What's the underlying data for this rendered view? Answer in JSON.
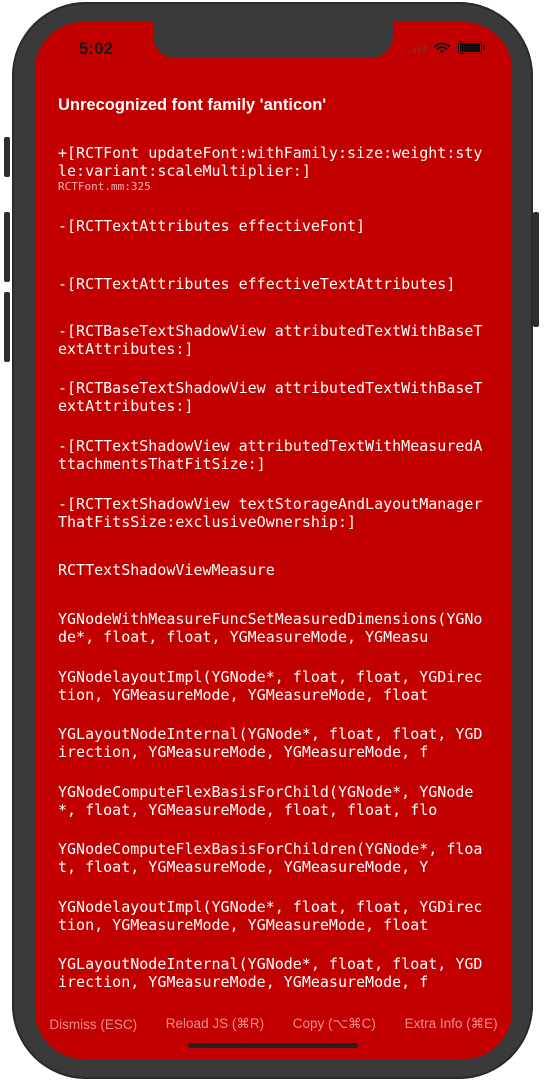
{
  "status_bar": {
    "time": "5:02"
  },
  "error": {
    "title": "Unrecognized font family 'anticon'",
    "frames": [
      {
        "method": "+[RCTFont updateFont:withFamily:size:weight:style:variant:scaleMultiplier:]",
        "location": "RCTFont.mm:325"
      },
      {
        "method": "-[RCTTextAttributes effectiveFont]"
      },
      {
        "method": "-[RCTTextAttributes effectiveTextAttributes]"
      },
      {
        "method": "-[RCTBaseTextShadowView attributedTextWithBaseTextAttributes:]"
      },
      {
        "method": "-[RCTBaseTextShadowView attributedTextWithBaseTextAttributes:]"
      },
      {
        "method": "-[RCTTextShadowView attributedTextWithMeasuredAttachmentsThatFitSize:]"
      },
      {
        "method": "-[RCTTextShadowView textStorageAndLayoutManagerThatFitsSize:exclusiveOwnership:]"
      },
      {
        "method": "RCTTextShadowViewMeasure"
      },
      {
        "method": "YGNodeWithMeasureFuncSetMeasuredDimensions(YGNode*, float, float, YGMeasureMode, YGMeasu"
      },
      {
        "method": "YGNodelayoutImpl(YGNode*, float, float, YGDirection, YGMeasureMode, YGMeasureMode, float"
      },
      {
        "method": "YGLayoutNodeInternal(YGNode*, float, float, YGDirection, YGMeasureMode, YGMeasureMode, f"
      },
      {
        "method": "YGNodeComputeFlexBasisForChild(YGNode*, YGNode*, float, YGMeasureMode, float, float, flo"
      },
      {
        "method": "YGNodeComputeFlexBasisForChildren(YGNode*, float, float, YGMeasureMode, YGMeasureMode, Y"
      },
      {
        "method": "YGNodelayoutImpl(YGNode*, float, float, YGDirection, YGMeasureMode, YGMeasureMode, float"
      },
      {
        "method": "YGLayoutNodeInternal(YGNode*, float, float, YGDirection, YGMeasureMode, YGMeasureMode, f"
      }
    ]
  },
  "toolbar": {
    "dismiss": "Dismiss (ESC)",
    "reload": "Reload JS (⌘R)",
    "copy": "Copy (⌥⌘C)",
    "extra_info": "Extra Info (⌘E)"
  },
  "colors": {
    "background": "#c20000",
    "text": "#ffffff",
    "toolbar_text": "#f08c8c"
  }
}
